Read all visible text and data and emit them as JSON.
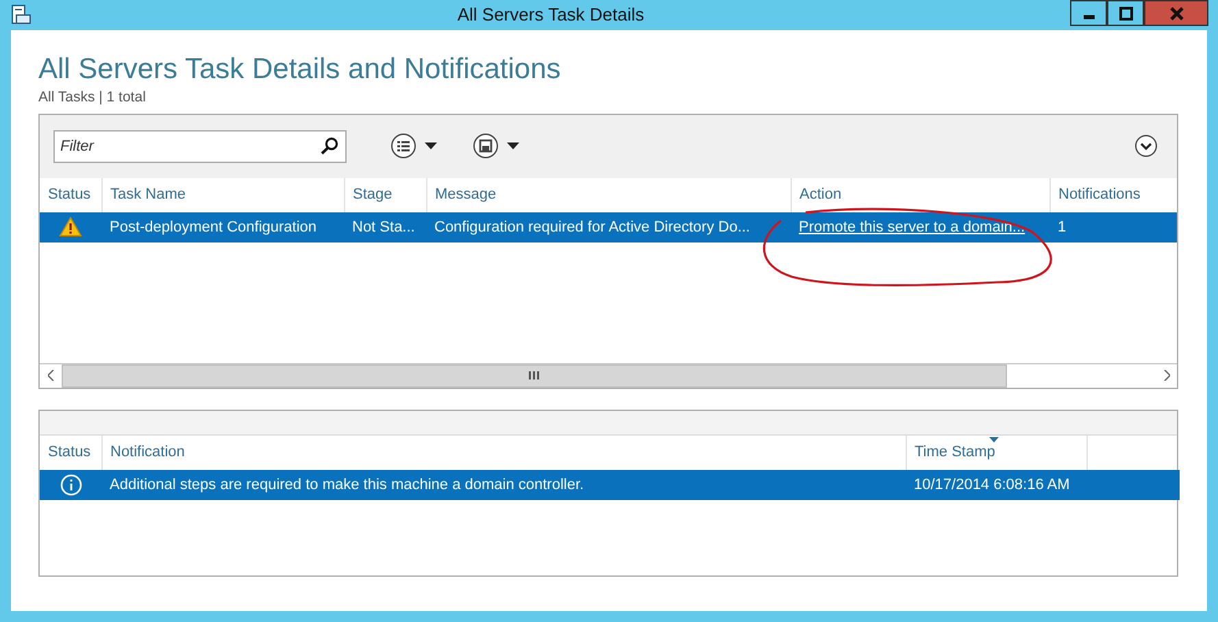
{
  "window": {
    "title": "All Servers Task Details"
  },
  "heading": "All Servers Task Details and Notifications",
  "subtitle": "All Tasks | 1 total",
  "filter": {
    "placeholder": "Filter"
  },
  "tasks": {
    "columns": [
      {
        "label": "Status"
      },
      {
        "label": "Task Name"
      },
      {
        "label": "Stage"
      },
      {
        "label": "Message"
      },
      {
        "label": "Action"
      },
      {
        "label": "Notifications"
      }
    ],
    "rows": [
      {
        "kind": "warning",
        "selected": true,
        "task_name": "Post-deployment Configuration",
        "stage": "Not Sta...",
        "message": "Configuration required for Active Directory Do...",
        "action": "Promote this server to a domain...",
        "notifications": "1"
      }
    ]
  },
  "notifications": {
    "columns": [
      {
        "label": "Status",
        "sorted": false
      },
      {
        "label": "Notification",
        "sorted": false
      },
      {
        "label": "Time Stamp",
        "sorted": true
      },
      {
        "sorted": false
      }
    ],
    "rows": [
      {
        "kind": "info",
        "selected": true,
        "notification": "Additional steps are required to make this machine a domain controller.",
        "time_stamp": "10/17/2014 6:08:16 AM"
      }
    ]
  },
  "annotations": [
    {
      "kind": "ellipse"
    }
  ]
}
